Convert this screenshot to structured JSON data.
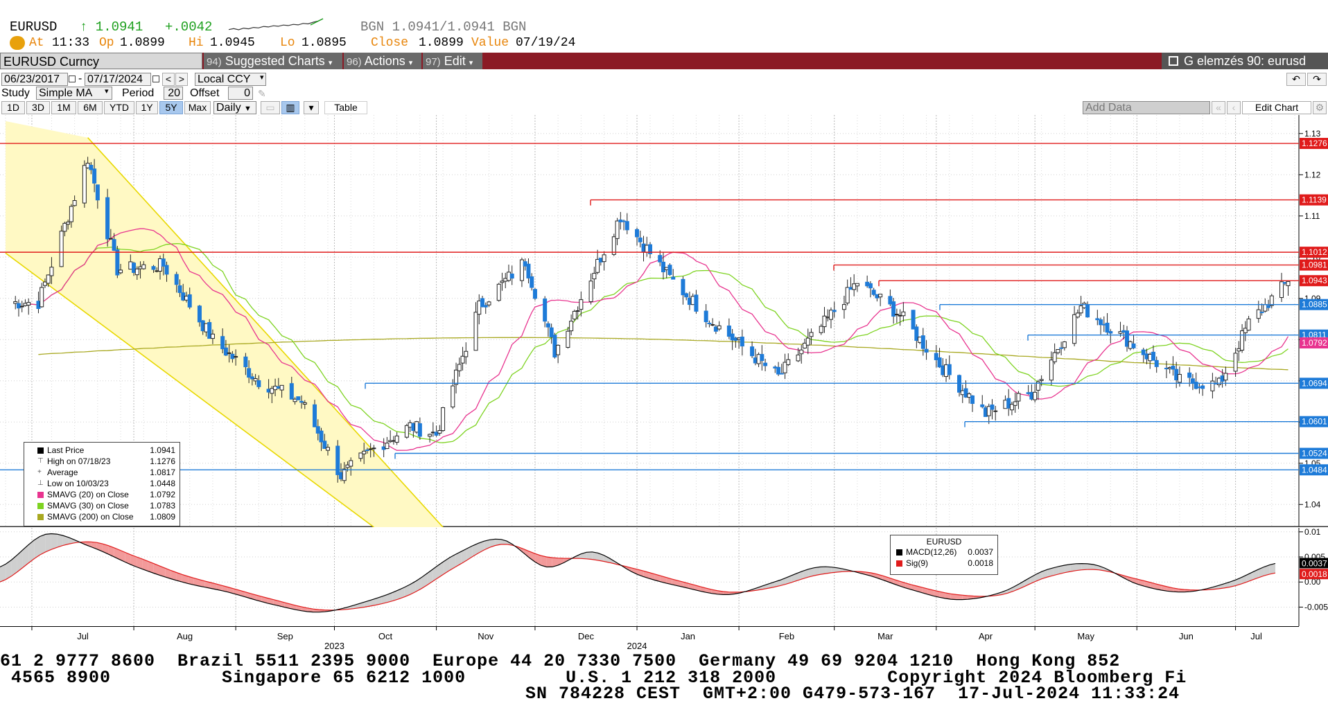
{
  "quote": {
    "ticker": "EURUSD",
    "last": "↑ 1.0941",
    "change": "+.0042",
    "bgn_bid_ask": "BGN  1.0941/1.0941  BGN",
    "at_label": "At",
    "time": "11:33",
    "op_label": "Op",
    "op": "1.0899",
    "hi_label": "Hi",
    "hi": "1.0945",
    "lo_label": "Lo",
    "lo": "1.0895",
    "close_label": "Close",
    "close": "1.0899",
    "value_label": "Value",
    "value": "07/19/24",
    "sparkline": [
      1.0899,
      1.0903,
      1.0898,
      1.0905,
      1.0902,
      1.0908,
      1.0906,
      1.0912,
      1.091,
      1.0915,
      1.0913,
      1.0918,
      1.0916,
      1.0921,
      1.0919,
      1.0925,
      1.0923,
      1.093,
      1.0935,
      1.0945
    ]
  },
  "toolbar": {
    "security": "EURUSD Curncy",
    "suggested_num": "94)",
    "suggested": "Suggested Charts",
    "actions_num": "96)",
    "actions": "Actions",
    "edit_num": "97)",
    "edit": "Edit",
    "right_title": "G elemzés 90: eurusd"
  },
  "controls": {
    "date_from": "06/23/2017",
    "date_to": "07/17/2024",
    "currency": "Local CCY",
    "study_label": "Study",
    "study": "Simple MA",
    "period_label": "Period",
    "period": "20",
    "offset_label": "Offset",
    "offset": "0",
    "ranges": [
      "1D",
      "3D",
      "1M",
      "6M",
      "YTD",
      "1Y",
      "5Y",
      "Max"
    ],
    "active_range": "5Y",
    "interval": "Daily",
    "table_btn": "Table",
    "add_data": "Add Data",
    "edit_chart": "Edit Chart"
  },
  "legend": {
    "rows": [
      {
        "label": "Last Price",
        "value": "1.0941",
        "color": "#000000"
      },
      {
        "label": "High on 07/18/23",
        "value": "1.1276",
        "color": ""
      },
      {
        "label": "Average",
        "value": "1.0817",
        "color": ""
      },
      {
        "label": "Low on 10/03/23",
        "value": "1.0448",
        "color": ""
      },
      {
        "label": "SMAVG (20)  on Close",
        "value": "1.0792",
        "color": "#e8348f"
      },
      {
        "label": "SMAVG (30)  on Close",
        "value": "1.0783",
        "color": "#7ed321"
      },
      {
        "label": "SMAVG (200)  on Close",
        "value": "1.0809",
        "color": "#a8a820"
      }
    ]
  },
  "macd_legend": {
    "title": "EURUSD",
    "rows": [
      {
        "label": "MACD(12,26)",
        "value": "0.0037",
        "color": "#000000"
      },
      {
        "label": "Sig(9)",
        "value": "0.0018",
        "color": "#e01b1b"
      }
    ]
  },
  "chart_data": [
    {
      "type": "candlestick",
      "title": "",
      "xlabel": "",
      "ylabel": "",
      "ylim": [
        1.0345,
        1.1345
      ],
      "x_months": [
        {
          "label": "Jul",
          "year": ""
        },
        {
          "label": "Aug",
          "year": ""
        },
        {
          "label": "Sep",
          "year": ""
        },
        {
          "label": "Oct",
          "year": "2023"
        },
        {
          "label": "Nov",
          "year": ""
        },
        {
          "label": "Dec",
          "year": ""
        },
        {
          "label": "Jan",
          "year": "2024"
        },
        {
          "label": "Feb",
          "year": ""
        },
        {
          "label": "Mar",
          "year": ""
        },
        {
          "label": "Apr",
          "year": ""
        },
        {
          "label": "May",
          "year": ""
        },
        {
          "label": "Jun",
          "year": ""
        },
        {
          "label": "Jul",
          "year": ""
        }
      ],
      "y_ticks": [
        "1.13",
        "1.12",
        "1.11",
        "1.10",
        "1.09",
        "1.08",
        "1.07",
        "1.06",
        "1.05",
        "1.04"
      ],
      "horizontal_levels": [
        {
          "value": 1.1276,
          "label": "1.1276",
          "color": "#e01b1b"
        },
        {
          "value": 1.1139,
          "label": "1.1139",
          "color": "#e01b1b"
        },
        {
          "value": 1.1012,
          "label": "1.1012",
          "color": "#e01b1b"
        },
        {
          "value": 1.0981,
          "label": "1.0981",
          "color": "#e01b1b"
        },
        {
          "value": 1.0943,
          "label": "1.0943",
          "color": "#e01b1b"
        },
        {
          "value": 1.0885,
          "label": "1.0885",
          "color": "#1e7bd8"
        },
        {
          "value": 1.0811,
          "label": "1.0811",
          "color": "#1e7bd8"
        },
        {
          "value": 1.0792,
          "label": "1.0792",
          "color": "#e8348f"
        },
        {
          "value": 1.0694,
          "label": "1.0694",
          "color": "#1e7bd8"
        },
        {
          "value": 1.0601,
          "label": "1.0601",
          "color": "#1e7bd8"
        },
        {
          "value": 1.0524,
          "label": "1.0524",
          "color": "#1e7bd8"
        },
        {
          "value": 1.0484,
          "label": "1.0484",
          "color": "#1e7bd8"
        }
      ],
      "close_series": [
        {
          "date": "2023-07-03",
          "close": 1.089
        },
        {
          "date": "2023-07-18",
          "close": 1.124
        },
        {
          "date": "2023-07-27",
          "close": 1.097
        },
        {
          "date": "2023-08-10",
          "close": 1.098
        },
        {
          "date": "2023-08-25",
          "close": 1.08
        },
        {
          "date": "2023-09-08",
          "close": 1.07
        },
        {
          "date": "2023-09-21",
          "close": 1.065
        },
        {
          "date": "2023-10-03",
          "close": 1.047
        },
        {
          "date": "2023-10-12",
          "close": 1.053
        },
        {
          "date": "2023-10-24",
          "close": 1.059
        },
        {
          "date": "2023-11-01",
          "close": 1.057
        },
        {
          "date": "2023-11-14",
          "close": 1.088
        },
        {
          "date": "2023-11-28",
          "close": 1.099
        },
        {
          "date": "2023-12-07",
          "close": 1.077
        },
        {
          "date": "2023-12-27",
          "close": 1.11
        },
        {
          "date": "2024-01-11",
          "close": 1.095
        },
        {
          "date": "2024-01-23",
          "close": 1.085
        },
        {
          "date": "2024-02-13",
          "close": 1.071
        },
        {
          "date": "2024-02-27",
          "close": 1.084
        },
        {
          "date": "2024-03-08",
          "close": 1.094
        },
        {
          "date": "2024-03-21",
          "close": 1.086
        },
        {
          "date": "2024-04-02",
          "close": 1.074
        },
        {
          "date": "2024-04-16",
          "close": 1.062
        },
        {
          "date": "2024-04-30",
          "close": 1.067
        },
        {
          "date": "2024-05-15",
          "close": 1.088
        },
        {
          "date": "2024-05-29",
          "close": 1.08
        },
        {
          "date": "2024-06-14",
          "close": 1.07
        },
        {
          "date": "2024-06-26",
          "close": 1.069
        },
        {
          "date": "2024-07-05",
          "close": 1.084
        },
        {
          "date": "2024-07-17",
          "close": 1.0941
        }
      ]
    },
    {
      "type": "line",
      "title": "",
      "ylim": [
        -0.0088,
        0.0108
      ],
      "y_ticks": [
        "0.01",
        "0.005",
        "0.00",
        "-0.005"
      ],
      "value_labels": [
        "0.0037",
        "0.0018"
      ],
      "series": [
        {
          "name": "MACD(12,26)",
          "color": "#000000",
          "values": [
            0.003,
            0.0095,
            0.007,
            0.003,
            0.0,
            -0.002,
            -0.0045,
            -0.006,
            -0.004,
            -0.0005,
            0.0055,
            0.0085,
            0.003,
            0.006,
            0.0015,
            -0.001,
            -0.0025,
            0.0,
            0.003,
            0.0015,
            -0.0015,
            -0.0035,
            -0.002,
            0.0025,
            0.0035,
            -0.0005,
            -0.002,
            0.0,
            0.0037
          ]
        },
        {
          "name": "Sig(9)",
          "color": "#e01b1b",
          "values": [
            0.0,
            0.006,
            0.008,
            0.005,
            0.0015,
            -0.001,
            -0.0035,
            -0.0055,
            -0.005,
            -0.0025,
            0.003,
            0.0075,
            0.005,
            0.0045,
            0.0025,
            0.0,
            -0.002,
            -0.001,
            0.0015,
            0.002,
            -0.0005,
            -0.0025,
            -0.0025,
            0.001,
            0.0025,
            0.0005,
            -0.0015,
            -0.001,
            0.0018
          ]
        }
      ]
    }
  ],
  "ticker": {
    "line1": "61 2 9777 8600  Brazil 5511 2395 9000  Europe 44 20 7330 7500  Germany 49 69 9204 1210  Hong Kong 852",
    "line2": " 4565 8900          Singapore 65 6212 1000         U.S. 1 212 318 2000          Copyright 2024 Bloomberg Fi",
    "line3": "SN 784228 CEST  GMT+2:00 G479-573-167  17-Jul-2024 11:33:24"
  }
}
